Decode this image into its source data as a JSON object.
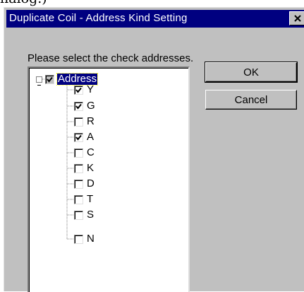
{
  "caption_fragment": "nalog.)",
  "dialog": {
    "title": "Duplicate Coil - Address Kind Setting",
    "close_symbol": "X",
    "prompt": "Please select the check addresses.",
    "root": {
      "label": "Address",
      "checked": true,
      "selected": true,
      "expanded": true,
      "expander_symbol": "-"
    },
    "items": [
      {
        "label": "Y",
        "checked": true
      },
      {
        "label": "G",
        "checked": true
      },
      {
        "label": "R",
        "checked": false
      },
      {
        "label": "A",
        "checked": true
      },
      {
        "label": "C",
        "checked": false
      },
      {
        "label": "K",
        "checked": false
      },
      {
        "label": "D",
        "checked": false
      },
      {
        "label": "T",
        "checked": false
      },
      {
        "label": "S",
        "checked": false
      },
      {
        "label": "N",
        "checked": false
      }
    ],
    "ok_label": "OK",
    "cancel_label": "Cancel"
  }
}
